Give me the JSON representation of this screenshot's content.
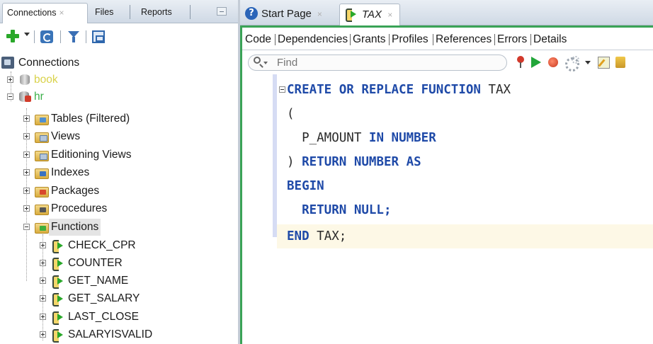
{
  "left_panel": {
    "tabs": [
      {
        "label": "Connections",
        "close": "×"
      },
      {
        "label": "Files"
      },
      {
        "label": "Reports"
      }
    ],
    "toolbar_icons": [
      "add-connection-icon",
      "dropdown-icon",
      "refresh-icon",
      "filter-icon",
      "schema-browser-icon"
    ],
    "tree": {
      "root": "Connections",
      "nodes": [
        {
          "label": "book",
          "icon": "database-icon",
          "color": "#d9d24a"
        },
        {
          "label": "hr",
          "icon": "database-connected-icon",
          "color": "#3bb04a"
        },
        {
          "label": "Tables (Filtered)",
          "icon": "tables-folder-icon"
        },
        {
          "label": "Views",
          "icon": "views-folder-icon"
        },
        {
          "label": "Editioning Views",
          "icon": "editioning-views-folder-icon"
        },
        {
          "label": "Indexes",
          "icon": "indexes-folder-icon"
        },
        {
          "label": "Packages",
          "icon": "packages-folder-icon"
        },
        {
          "label": "Procedures",
          "icon": "procedures-folder-icon"
        },
        {
          "label": "Functions",
          "icon": "functions-folder-icon"
        },
        {
          "label": "CHECK_CPR",
          "icon": "function-icon"
        },
        {
          "label": "COUNTER",
          "icon": "function-icon"
        },
        {
          "label": "GET_NAME",
          "icon": "function-icon"
        },
        {
          "label": "GET_SALARY",
          "icon": "function-icon"
        },
        {
          "label": "LAST_CLOSE",
          "icon": "function-icon"
        },
        {
          "label": "SALARYISVALID",
          "icon": "function-icon"
        }
      ]
    }
  },
  "editor": {
    "tabs": [
      {
        "label": "Start Page",
        "icon": "help-icon",
        "close": "×"
      },
      {
        "label": "TAX",
        "icon": "function-icon",
        "close": "×",
        "active": true
      }
    ],
    "subtabs": [
      "Code",
      "Dependencies",
      "Grants",
      "Profiles",
      "References",
      "Errors",
      "Details"
    ],
    "find_placeholder": "Find",
    "toolbar_icons": [
      "pin-icon",
      "run-icon",
      "debug-icon",
      "compile-icon",
      "dropdown-icon",
      "edit-icon",
      "extra-icon"
    ],
    "code": {
      "l1_kw": "CREATE OR REPLACE FUNCTION",
      "l1_id": "TAX",
      "l2": "(",
      "l3_id": "P_AMOUNT",
      "l3_kw": "IN NUMBER",
      "l4_paren": ")",
      "l4_kw": "RETURN NUMBER AS",
      "l5": "BEGIN",
      "l6": "RETURN NULL;",
      "l7_kw": "END",
      "l7_id": "TAX;"
    }
  },
  "colors": {
    "keyword": "#1f4aa8",
    "identifier": "#2a2a2a",
    "editor_border": "#3aa357",
    "current_line": "#fdf8e6"
  }
}
